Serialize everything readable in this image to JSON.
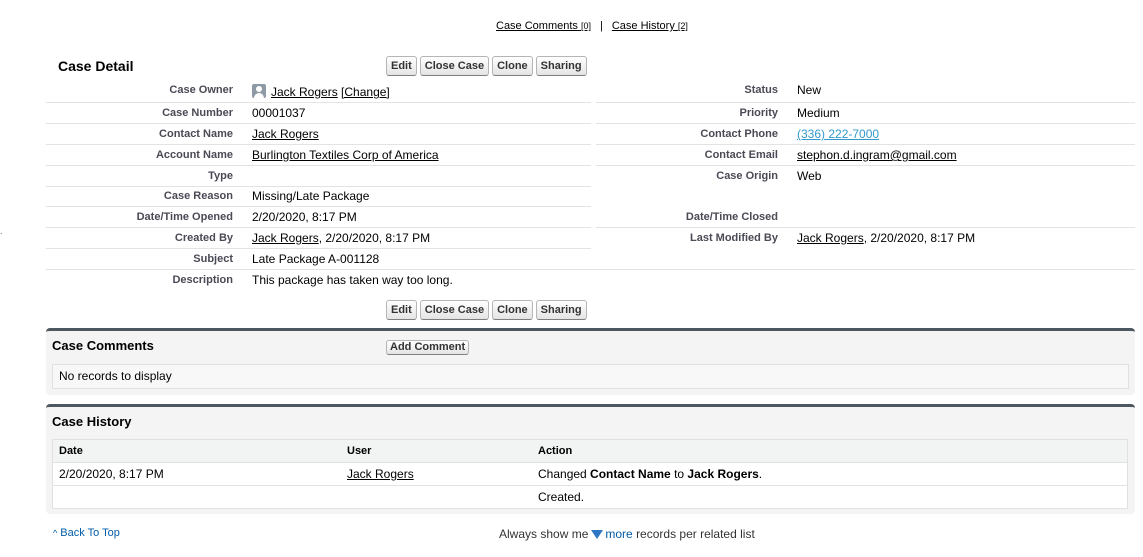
{
  "top_links": {
    "case_comments": "Case Comments",
    "case_comments_count": "[0]",
    "separator": "|",
    "case_history": "Case History",
    "case_history_count": "[2]"
  },
  "detail": {
    "title": "Case Detail",
    "buttons": {
      "edit": "Edit",
      "close_case": "Close Case",
      "clone": "Clone",
      "sharing": "Sharing"
    },
    "left_fields": [
      {
        "label": "Case Owner",
        "value": "Jack Rogers",
        "extra": "[Change]"
      },
      {
        "label": "Case Number",
        "value": "00001037"
      },
      {
        "label": "Contact Name",
        "value": "Jack Rogers"
      },
      {
        "label": "Account Name",
        "value": "Burlington Textiles Corp of America"
      },
      {
        "label": "Type",
        "value": ""
      },
      {
        "label": "Case Reason",
        "value": "Missing/Late Package"
      },
      {
        "label": "Date/Time Opened",
        "value": "2/20/2020, 8:17 PM"
      },
      {
        "label": "Created By",
        "value": "Jack Rogers",
        "extra": ", 2/20/2020, 8:17 PM"
      },
      {
        "label": "Subject",
        "value": "Late Package A-001128"
      },
      {
        "label": "Description",
        "value": "This package has taken way too long."
      }
    ],
    "right_fields": [
      {
        "label": "Status",
        "value": "New"
      },
      {
        "label": "Priority",
        "value": "Medium"
      },
      {
        "label": "Contact Phone",
        "value": "(336) 222-7000"
      },
      {
        "label": "Contact Email",
        "value": "stephon.d.ingram@gmail.com"
      },
      {
        "label": "Case Origin",
        "value": "Web"
      },
      {
        "label": "Date/Time Closed",
        "value": ""
      },
      {
        "label": "Last Modified By",
        "value": "Jack Rogers",
        "extra": ", 2/20/2020, 8:17 PM"
      }
    ]
  },
  "comments": {
    "title": "Case Comments",
    "add_button": "Add Comment",
    "empty_text": "No records to display"
  },
  "history": {
    "title": "Case History",
    "columns": [
      "Date",
      "User",
      "Action"
    ],
    "rows": [
      {
        "date": "2/20/2020, 8:17 PM",
        "user": "Jack Rogers",
        "action_pre": "Changed ",
        "action_field": "Contact Name",
        "action_mid": " to ",
        "action_value": "Jack Rogers",
        "action_post": "."
      },
      {
        "date": "",
        "user": "",
        "action_pre": "Created."
      }
    ]
  },
  "footer": {
    "back_to_top": "Back To Top",
    "back_caret": "^",
    "always_show": "Always show me",
    "more": "more",
    "records_text": "records per related list"
  },
  "colors": {
    "accent_link": "#015ba7",
    "phone_link": "#3399cc",
    "panel_border": "#4d5760"
  }
}
